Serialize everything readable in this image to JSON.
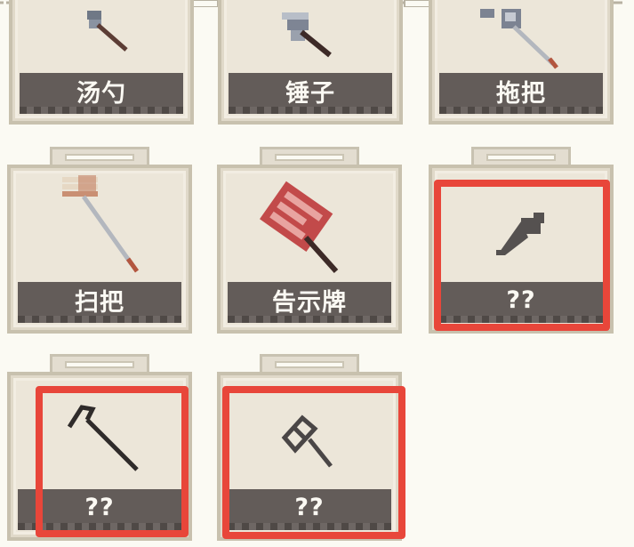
{
  "items": [
    {
      "label": "汤勺",
      "icon": "ladle-icon"
    },
    {
      "label": "锤子",
      "icon": "hammer-icon"
    },
    {
      "label": "拖把",
      "icon": "mop-icon"
    },
    {
      "label": "扫把",
      "icon": "broom-icon"
    },
    {
      "label": "告示牌",
      "icon": "signboard-icon"
    },
    {
      "label": "??",
      "icon": "unknown-blade-icon"
    },
    {
      "label": "??",
      "icon": "unknown-cane-icon"
    },
    {
      "label": "??",
      "icon": "unknown-shovel-icon"
    }
  ],
  "colors": {
    "highlight": "#e8463a",
    "label_bg": "#635c59",
    "card_bg": "#ece6d9",
    "page_bg": "#fbfaf3"
  }
}
